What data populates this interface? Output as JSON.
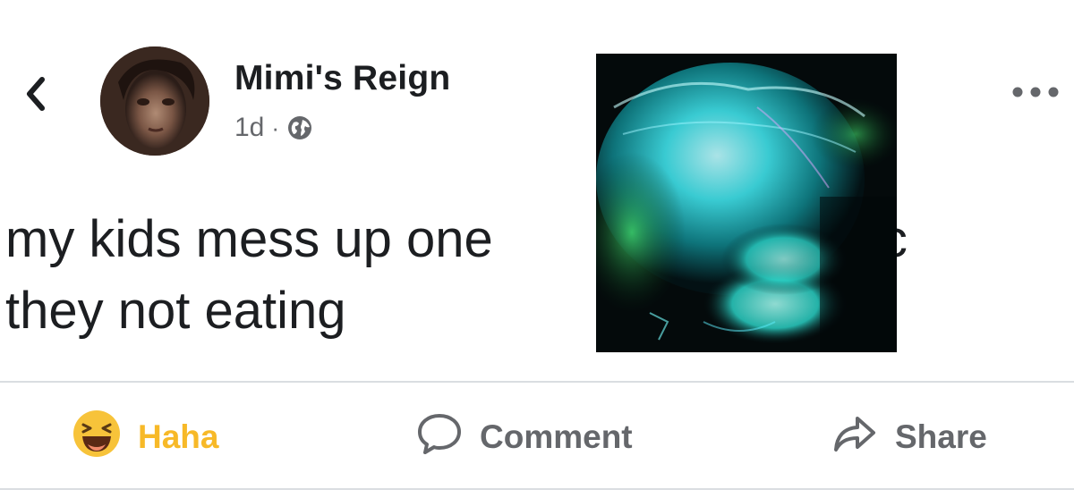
{
  "post": {
    "author": "Mimi's Reign",
    "timestamp": "1d",
    "separator": "·",
    "audience_icon": "globe-icon",
    "text_line1_part1": "my kids mess up one",
    "text_line1_part2": "lyric",
    "text_line2": "they not eating"
  },
  "header": {
    "back_icon": "chevron-left-icon",
    "more_icon": "more-options-icon"
  },
  "actions": {
    "reaction_label": "Haha",
    "reaction_icon": "haha-emoji-icon",
    "comment_label": "Comment",
    "comment_icon": "comment-icon",
    "share_label": "Share",
    "share_icon": "share-icon"
  },
  "colors": {
    "haha_yellow": "#f7b928",
    "secondary_text": "#65676b",
    "primary_text": "#1c1e21",
    "divider": "#dadde1"
  }
}
